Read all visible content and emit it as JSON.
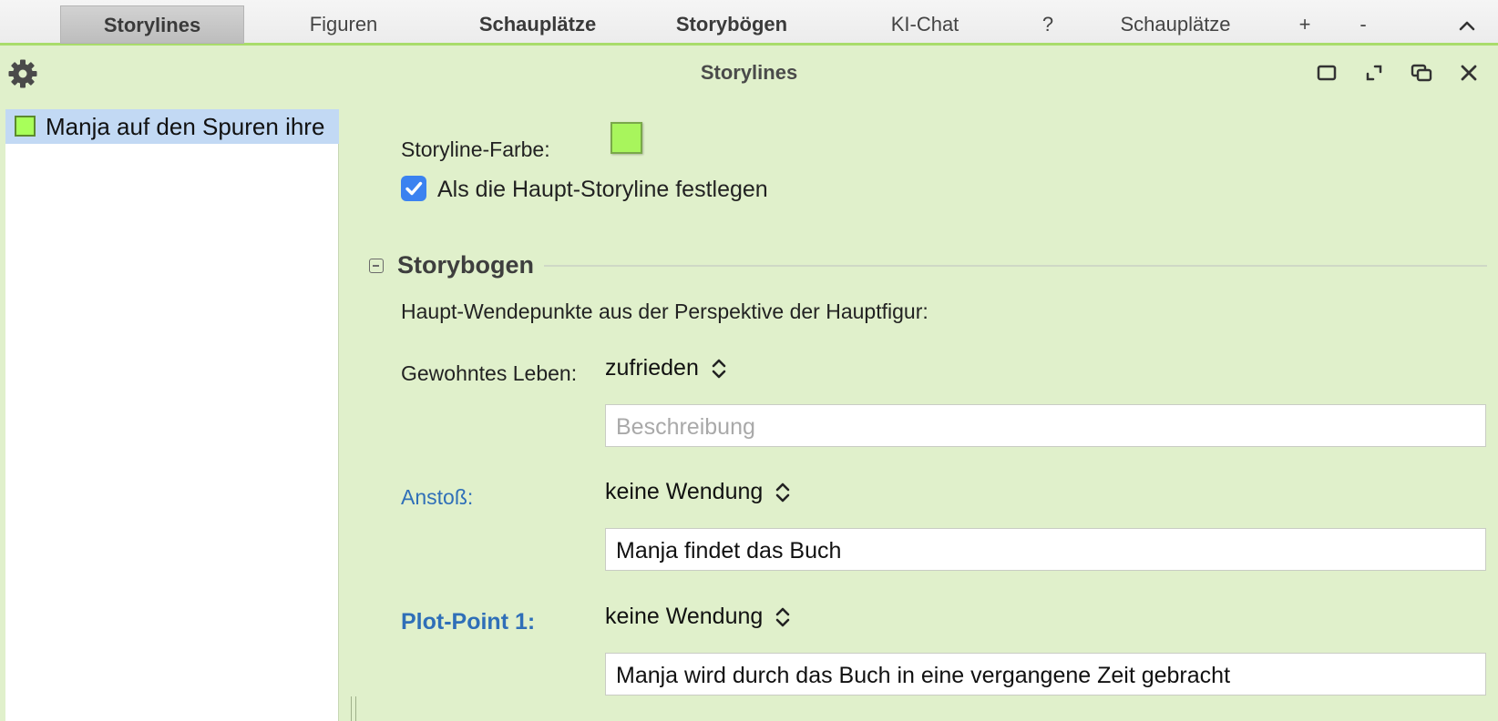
{
  "tabbar": {
    "tabs": [
      {
        "label": "Storylines"
      },
      {
        "label": "Figuren"
      },
      {
        "label": "Schauplätze"
      },
      {
        "label": "Storybögen"
      },
      {
        "label": "KI-Chat"
      },
      {
        "label": "?"
      },
      {
        "label": "Schauplätze"
      },
      {
        "label": "+"
      },
      {
        "label": "-"
      }
    ],
    "active_tab": "Storylines"
  },
  "panel": {
    "title": "Storylines"
  },
  "list": {
    "items": [
      {
        "label": "Manja auf den Spuren ihre",
        "color": "#a8ff5a",
        "selected": true
      }
    ]
  },
  "form": {
    "color_label": "Storyline-Farbe:",
    "storyline_color": "#a8f55c",
    "main_storyline_label": "Als die Haupt-Storyline festlegen",
    "main_storyline_checked": true,
    "section": {
      "title": "Storybogen",
      "subtitle": "Haupt-Wendepunkte aus der Perspektive der Hauptfigur:",
      "rows": [
        {
          "label": "Gewohntes Leben:",
          "select_value": "zufrieden",
          "description_value": "",
          "description_placeholder": "Beschreibung"
        },
        {
          "label": "Anstoß:",
          "select_value": "keine Wendung",
          "description_value": "Manja findet das Buch",
          "description_placeholder": "Beschreibung"
        },
        {
          "label": "Plot-Point 1:",
          "select_value": "keine Wendung",
          "description_value": "Manja wird durch das Buch in eine vergangene Zeit gebracht",
          "description_placeholder": "Beschreibung"
        }
      ]
    }
  },
  "colors": {
    "accent_blue": "#2f6fb8",
    "panel_background": "#e0f0cb",
    "tabbar_border": "#a9dc6b"
  }
}
